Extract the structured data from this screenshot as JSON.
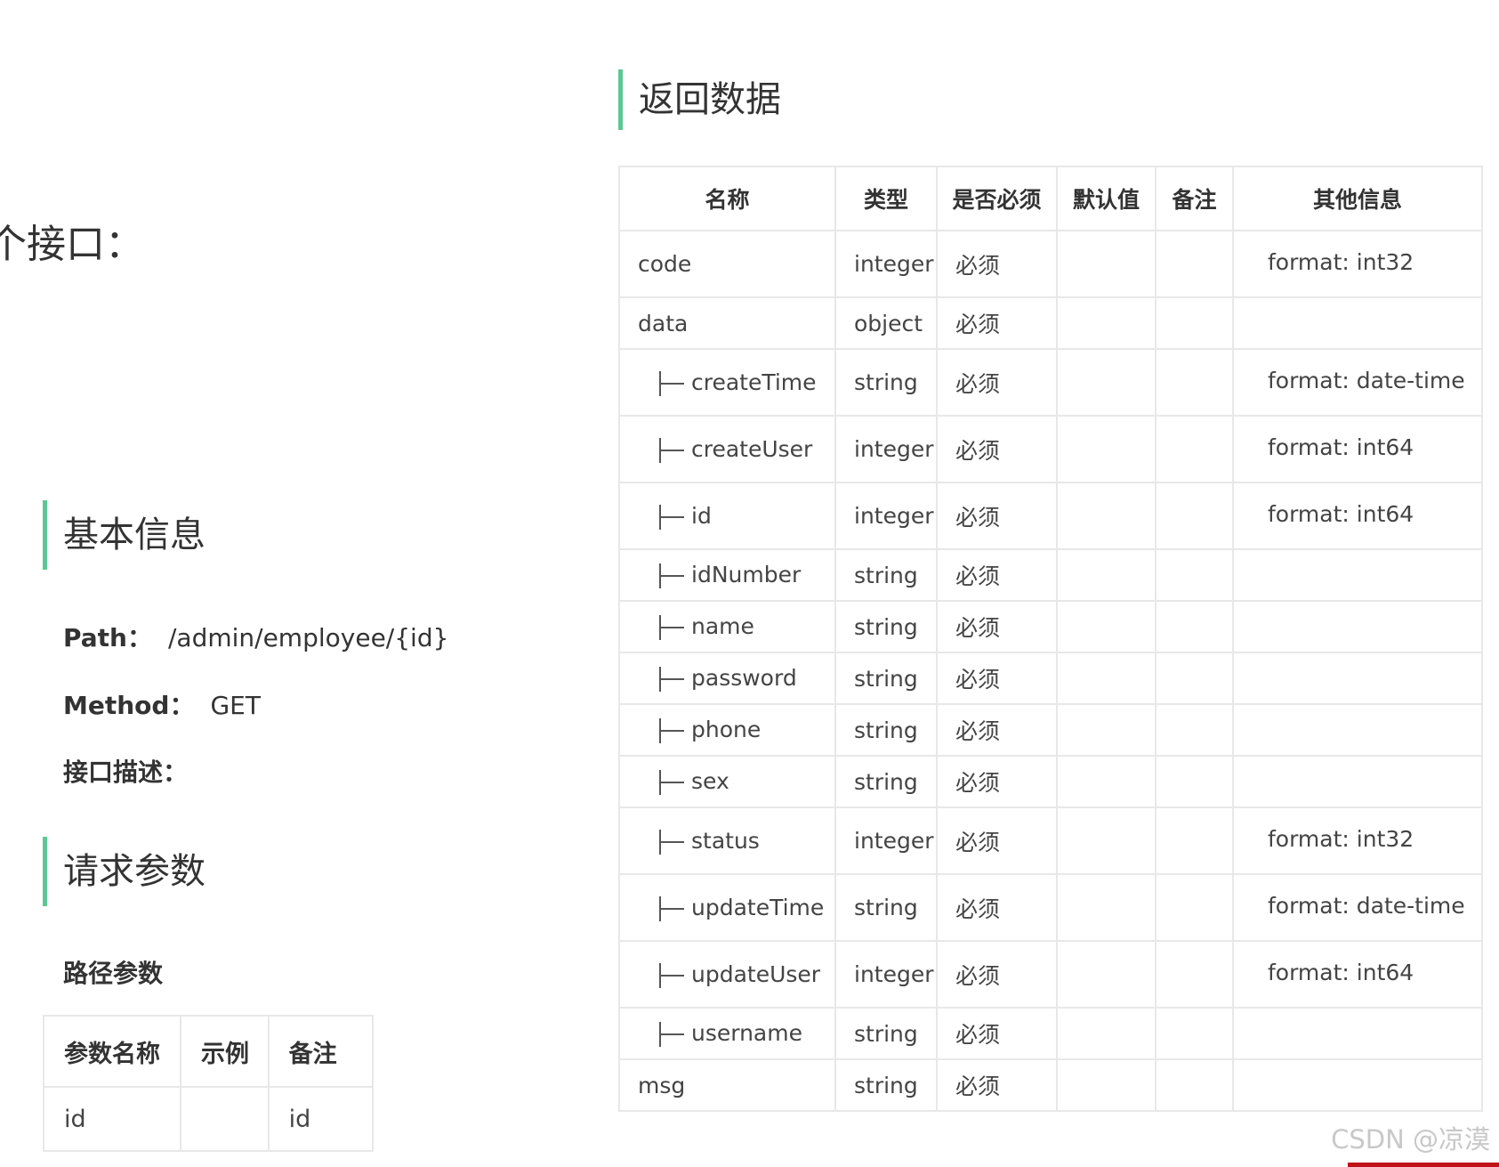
{
  "cut_heading": "个接口：",
  "sections": {
    "basic": "基本信息",
    "request": "请求参数",
    "return": "返回数据"
  },
  "basic": {
    "path_label": "Path：",
    "path_value": "/admin/employee/{id}",
    "method_label": "Method：",
    "method_value": "GET",
    "desc_label": "接口描述："
  },
  "path_params_label": "路径参数",
  "param_table": {
    "headers": [
      "参数名称",
      "示例",
      "备注"
    ],
    "rows": [
      [
        "id",
        "",
        "id"
      ]
    ]
  },
  "return_table": {
    "headers": [
      "名称",
      "类型",
      "是否必须",
      "默认值",
      "备注",
      "其他信息"
    ],
    "rows": [
      {
        "name": "code",
        "child": false,
        "type": "integer",
        "req": "必须",
        "other": "format: int32"
      },
      {
        "name": "data",
        "child": false,
        "type": "object",
        "req": "必须",
        "other": ""
      },
      {
        "name": "createTime",
        "child": true,
        "type": "string",
        "req": "必须",
        "other": "format: date-time"
      },
      {
        "name": "createUser",
        "child": true,
        "type": "integer",
        "req": "必须",
        "other": "format: int64"
      },
      {
        "name": "id",
        "child": true,
        "type": "integer",
        "req": "必须",
        "other": "format: int64"
      },
      {
        "name": "idNumber",
        "child": true,
        "type": "string",
        "req": "必须",
        "other": ""
      },
      {
        "name": "name",
        "child": true,
        "type": "string",
        "req": "必须",
        "other": ""
      },
      {
        "name": "password",
        "child": true,
        "type": "string",
        "req": "必须",
        "other": ""
      },
      {
        "name": "phone",
        "child": true,
        "type": "string",
        "req": "必须",
        "other": ""
      },
      {
        "name": "sex",
        "child": true,
        "type": "string",
        "req": "必须",
        "other": ""
      },
      {
        "name": "status",
        "child": true,
        "type": "integer",
        "req": "必须",
        "other": "format: int32"
      },
      {
        "name": "updateTime",
        "child": true,
        "type": "string",
        "req": "必须",
        "other": "format: date-time"
      },
      {
        "name": "updateUser",
        "child": true,
        "type": "integer",
        "req": "必须",
        "other": "format: int64"
      },
      {
        "name": "username",
        "child": true,
        "type": "string",
        "req": "必须",
        "other": ""
      },
      {
        "name": "msg",
        "child": false,
        "type": "string",
        "req": "必须",
        "other": ""
      }
    ]
  },
  "watermark": "CSDN @凉漠",
  "colors": {
    "accent": "#5cc894",
    "border": "#e8e8e8",
    "watermark_bar": "#c0121b"
  }
}
